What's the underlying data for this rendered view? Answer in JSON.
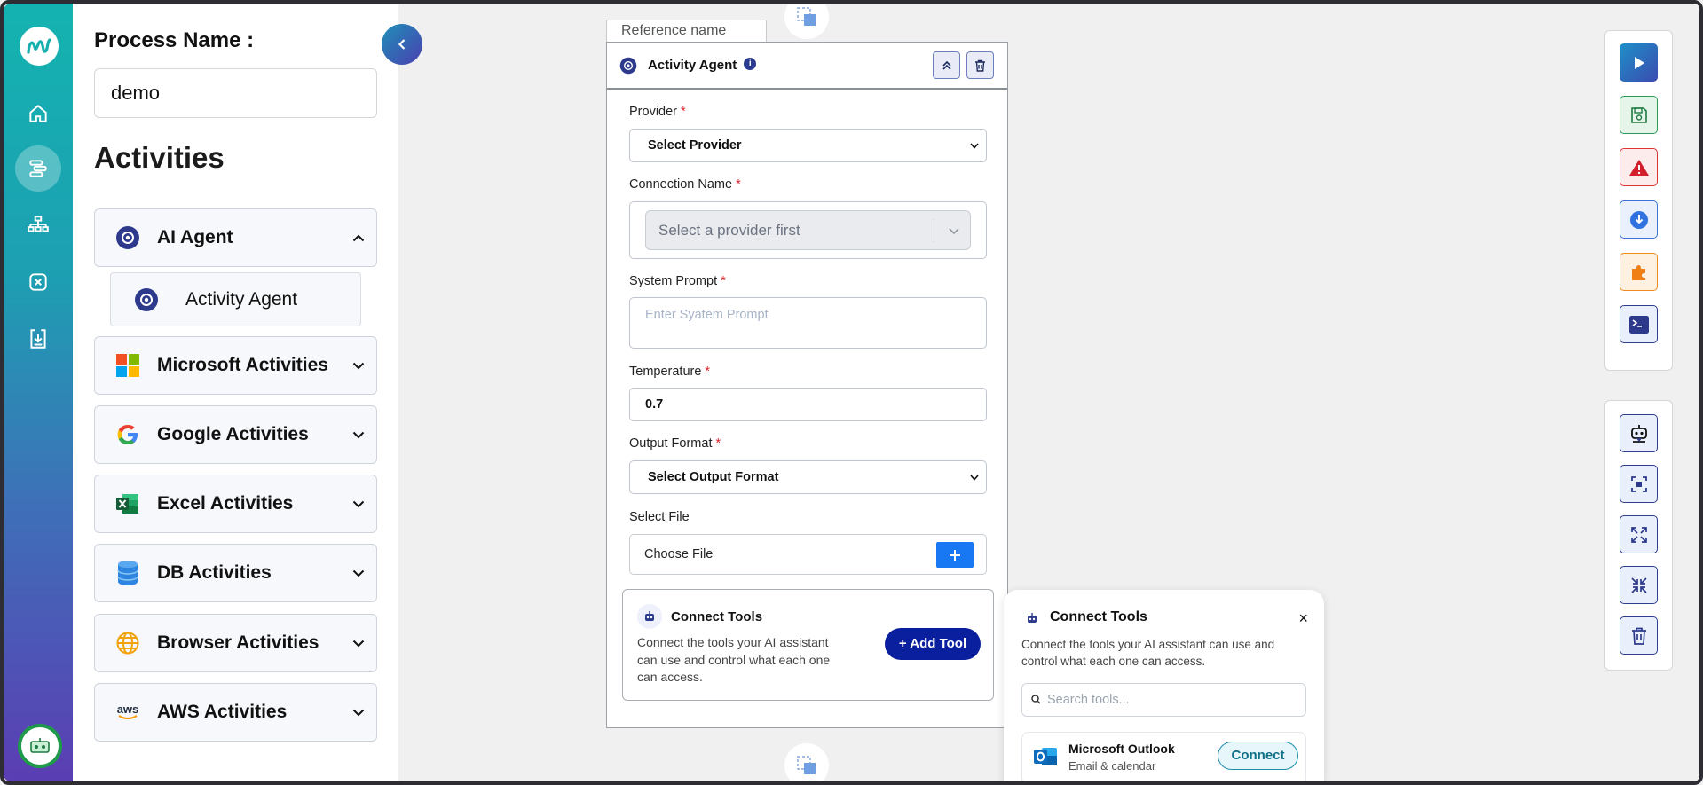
{
  "colors": {
    "rail_gradient_top": "#14b3b0",
    "rail_gradient_bottom": "#5b3db3",
    "add_tool": "#0a1f9e",
    "plus_button": "#1877f2",
    "required": "#e0242b"
  },
  "sidebar": {
    "nav": [
      "home-icon",
      "process-icon",
      "org-chart-icon",
      "variable-icon",
      "download-icon"
    ],
    "active": "process-icon",
    "bottom": "robot-icon"
  },
  "panel": {
    "process_label": "Process Name :",
    "process_value": "demo",
    "activities_title": "Activities",
    "categories": [
      {
        "label": "AI Agent",
        "icon": "gear-badge-icon",
        "expanded": true
      },
      {
        "label": "Microsoft Activities",
        "icon": "microsoft-icon"
      },
      {
        "label": "Google Activities",
        "icon": "google-icon"
      },
      {
        "label": "Excel Activities",
        "icon": "excel-icon"
      },
      {
        "label": "DB Activities",
        "icon": "database-icon"
      },
      {
        "label": "Browser Activities",
        "icon": "globe-icon"
      },
      {
        "label": "AWS Activities",
        "icon": "aws-icon"
      }
    ],
    "sub_item": "Activity Agent",
    "aws_logo_text": "aws"
  },
  "node": {
    "reference_placeholder": "Reference name",
    "title": "Activity Agent",
    "provider": {
      "label": "Provider",
      "value": "Select Provider"
    },
    "connection": {
      "label": "Connection Name",
      "placeholder": "Select a provider first"
    },
    "system_prompt": {
      "label": "System Prompt",
      "placeholder": "Enter Syatem Prompt"
    },
    "temperature": {
      "label": "Temperature",
      "value": "0.7"
    },
    "output_format": {
      "label": "Output Format",
      "value": "Select Output Format"
    },
    "select_file": {
      "label": "Select File",
      "button": "Choose File"
    },
    "required_mark": "*",
    "tools": {
      "title": "Connect Tools",
      "description": "Connect the tools your AI assistant can use and control what each one can access.",
      "add_button": "+ Add Tool"
    }
  },
  "popup": {
    "title": "Connect Tools",
    "description": "Connect the tools your AI assistant can use and control what each one can access.",
    "search_placeholder": "Search tools...",
    "close": "×",
    "items": [
      {
        "name": "Microsoft Outlook",
        "subtitle": "Email & calendar",
        "button": "Connect"
      }
    ]
  },
  "toolbar_top": [
    "run-icon",
    "save-icon",
    "warning-icon",
    "publish-icon",
    "plugin-icon",
    "terminal-icon"
  ],
  "toolbar_bottom": [
    "robot-icon",
    "focus-icon",
    "expand-icon",
    "collapse-icon",
    "delete-icon"
  ]
}
